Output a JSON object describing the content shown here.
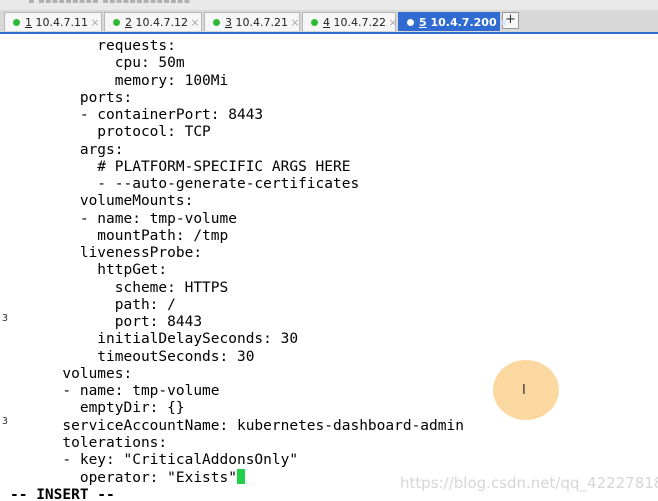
{
  "window": {
    "colors": {
      "active_tab": "#2f6bd1",
      "status_dot": "#2dbb36",
      "cursor": "#22d14a",
      "click_highlight": "#f6c87a"
    }
  },
  "tabs": [
    {
      "num": "1",
      "host": "10.4.7.11",
      "active": false
    },
    {
      "num": "2",
      "host": "10.4.7.12",
      "active": false
    },
    {
      "num": "3",
      "host": "10.4.7.21",
      "active": false
    },
    {
      "num": "4",
      "host": "10.4.7.22",
      "active": false
    },
    {
      "num": "5",
      "host": "10.4.7.200",
      "active": true
    }
  ],
  "tab_close_glyph": "×",
  "add_tab_glyph": "+",
  "gutter_marks": [
    "3",
    "3"
  ],
  "editor": {
    "lines": [
      "          requests:",
      "            cpu: 50m",
      "            memory: 100Mi",
      "        ports:",
      "        - containerPort: 8443",
      "          protocol: TCP",
      "        args:",
      "          # PLATFORM-SPECIFIC ARGS HERE",
      "          - --auto-generate-certificates",
      "        volumeMounts:",
      "        - name: tmp-volume",
      "          mountPath: /tmp",
      "        livenessProbe:",
      "          httpGet:",
      "            scheme: HTTPS",
      "            path: /",
      "            port: 8443",
      "          initialDelaySeconds: 30",
      "          timeoutSeconds: 30",
      "      volumes:",
      "      - name: tmp-volume",
      "        emptyDir: {}",
      "      serviceAccountName: kubernetes-dashboard-admin",
      "      tolerations:",
      "      - key: \"CriticalAddonsOnly\"",
      "        operator: \"Exists\""
    ],
    "mode": "-- INSERT --"
  },
  "cursor_icon": "text-cursor-icon",
  "watermark": "https://blog.csdn.net/qq_42227818"
}
